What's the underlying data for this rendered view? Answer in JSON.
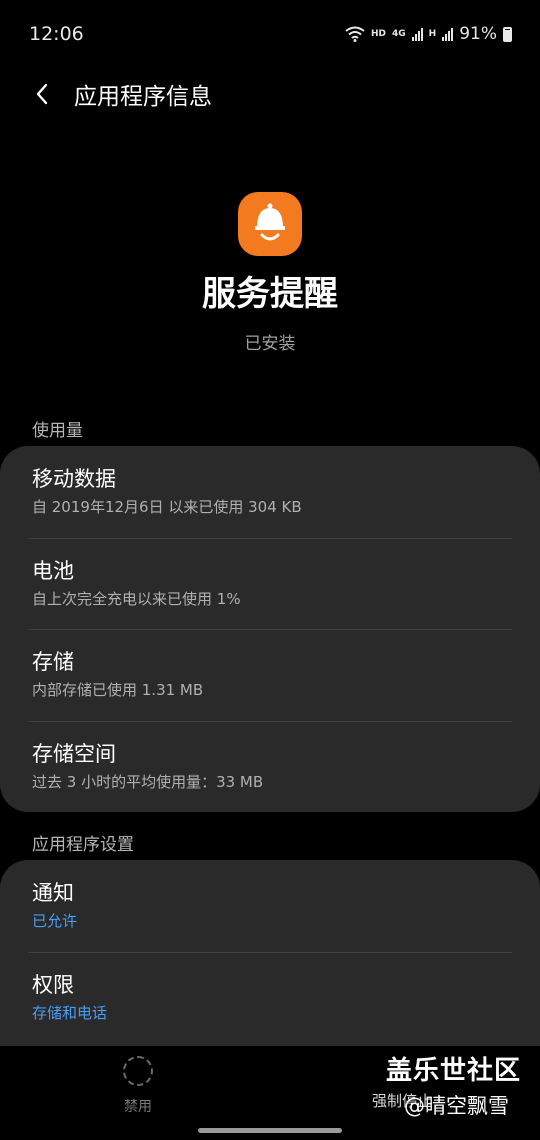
{
  "status": {
    "time": "12:06",
    "hd": "HD",
    "net_4g": "4G",
    "net_h": "H",
    "battery": "91%"
  },
  "app_bar": {
    "title": "应用程序信息"
  },
  "app": {
    "name": "服务提醒",
    "status": "已安装",
    "icon_color": "#f47a20"
  },
  "usage": {
    "header": "使用量",
    "items": [
      {
        "title": "移动数据",
        "sub": "自 2019年12月6日 以来已使用 304 KB"
      },
      {
        "title": "电池",
        "sub": "自上次完全充电以来已使用 1%"
      },
      {
        "title": "存储",
        "sub": "内部存储已使用 1.31 MB"
      },
      {
        "title": "存储空间",
        "sub": "过去 3 小时的平均使用量：33 MB"
      }
    ]
  },
  "settings": {
    "header": "应用程序设置",
    "items": [
      {
        "title": "通知",
        "sub": "已允许"
      },
      {
        "title": "权限",
        "sub": "存储和电话"
      }
    ]
  },
  "bottom": {
    "disable": "禁用",
    "force_stop": "强制停止"
  },
  "watermark": {
    "line1": "盖乐世社区",
    "line2": "@晴空飘雪"
  },
  "accent_color": "#4a9cf5"
}
